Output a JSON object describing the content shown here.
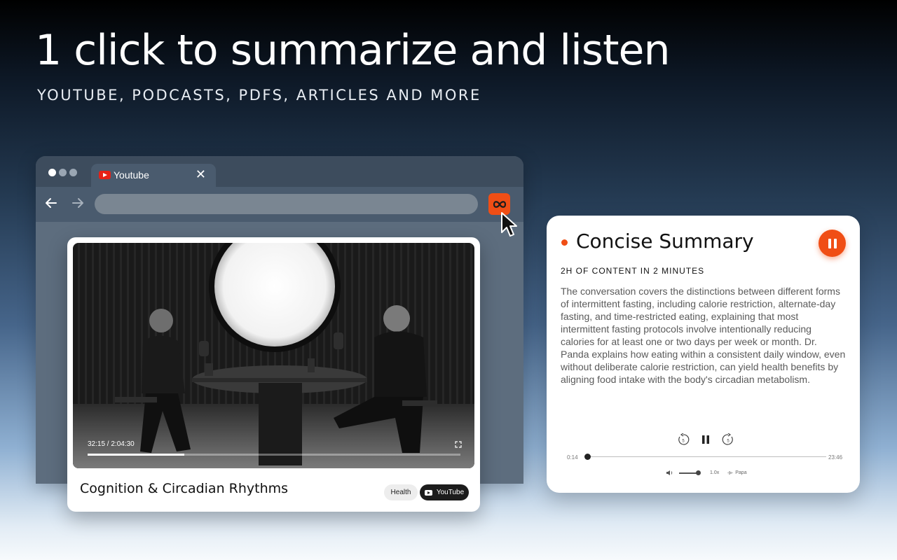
{
  "hero": {
    "title": "1 click to summarize and listen",
    "subtitle": "YOUTUBE, PODCASTS, PDFS, ARTICLES AND MORE"
  },
  "browser": {
    "tab_label": "Youtube",
    "tab_close": "✕",
    "tab_icon": "youtube-icon",
    "extension_icon": "infinity-icon",
    "url_value": ""
  },
  "video_card": {
    "time": "32:15 / 2:04:30",
    "progress": 0.26,
    "title": "Cognition & Circadian Rhythms",
    "tags": [
      "Health",
      "YouTube"
    ]
  },
  "summary": {
    "title": "Concise Summary",
    "subtitle": "2H OF CONTENT IN 2 MINUTES",
    "body": "The conversation covers the distinctions between different forms of intermittent fasting, including calorie restriction, alternate-day fasting, and time-restricted eating, explaining that most intermittent fasting protocols involve intentionally reducing calories for at least one or two days per week or month. Dr. Panda explains how eating within a consistent daily window, even without deliberate calorie restriction, can yield health benefits by aligning food intake with the body's circadian metabolism.",
    "rewind_label": "5",
    "forward_label": "5",
    "elapsed": "0:14",
    "total": "23:46",
    "speed": "1.0x",
    "voice": "Papa"
  },
  "colors": {
    "accent": "#f04e15",
    "browser_frame": "#4a5b6e",
    "tab_strip": "#3d4c5d"
  }
}
